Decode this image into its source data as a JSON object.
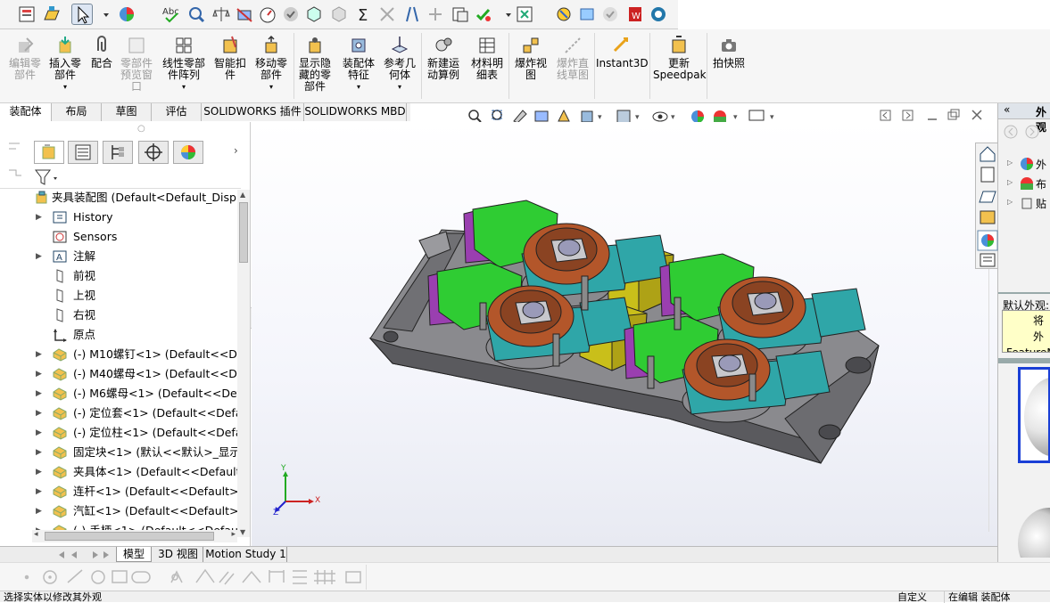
{
  "ribbon": {
    "edit_component": "编辑零\n部件",
    "insert_component": "插入零\n部件",
    "mate": "配合",
    "component_preview": "零部件\n预览窗\n口",
    "linear_pattern": "线性零部\n件阵列",
    "smart_fastener": "智能扣\n件",
    "move_component": "移动零\n部件",
    "show_hidden": "显示隐\n藏的零\n部件",
    "assembly_feature": "装配体\n特征",
    "reference_geometry": "参考几\n何体",
    "new_motion_study": "新建运\n动算例",
    "bom": "材料明\n细表",
    "exploded_view": "爆炸视\n图",
    "explode_line": "爆炸直\n线草图",
    "instant3d": "Instant3D",
    "update_speedpak": "更新\nSpeedpak",
    "snapshot": "拍快照"
  },
  "command_tabs": [
    "装配体",
    "布局",
    "草图",
    "评估",
    "SOLIDWORKS 插件",
    "SOLIDWORKS MBD"
  ],
  "tree": {
    "root": "夹具装配图 (Default<Default_Displa",
    "items": [
      {
        "label": "History",
        "expand": true,
        "icon": "history"
      },
      {
        "label": "Sensors",
        "expand": false,
        "icon": "sensor"
      },
      {
        "label": "注解",
        "expand": true,
        "icon": "annotation"
      },
      {
        "label": "前视",
        "expand": false,
        "icon": "plane"
      },
      {
        "label": "上视",
        "expand": false,
        "icon": "plane"
      },
      {
        "label": "右视",
        "expand": false,
        "icon": "plane"
      },
      {
        "label": "原点",
        "expand": false,
        "icon": "origin"
      },
      {
        "label": "(-) M10螺钉<1> (Default<<Defa",
        "expand": true,
        "icon": "part"
      },
      {
        "label": "(-) M40螺母<1> (Default<<Defa",
        "expand": true,
        "icon": "part"
      },
      {
        "label": "(-) M6螺母<1> (Default<<Defau",
        "expand": true,
        "icon": "part"
      },
      {
        "label": "(-) 定位套<1> (Default<<Defaul",
        "expand": true,
        "icon": "part"
      },
      {
        "label": "(-) 定位柱<1> (Default<<Defaul",
        "expand": true,
        "icon": "part"
      },
      {
        "label": "固定块<1> (默认<<默认>_显示状",
        "expand": true,
        "icon": "part"
      },
      {
        "label": "夹具体<1> (Default<<Default>_",
        "expand": true,
        "icon": "part"
      },
      {
        "label": "连杆<1> (Default<<Default>_Ph",
        "expand": true,
        "icon": "part"
      },
      {
        "label": "汽缸<1> (Default<<Default>_Ph",
        "expand": true,
        "icon": "part"
      },
      {
        "label": "(-) 手柄<1> (Default<<Default",
        "expand": true,
        "icon": "part"
      }
    ]
  },
  "bottom_tabs": [
    "模型",
    "3D 视图",
    "Motion Study 1"
  ],
  "right_panel": {
    "header": "外观",
    "default_label": "默认外观:",
    "tooltip_line1": "将外",
    "tooltip_line2": "FeatureM",
    "tree_items": [
      "外",
      "布",
      "贴"
    ]
  },
  "status": {
    "left": "选择实体以修改其外观",
    "custom": "自定义",
    "editing": "在编辑 装配体"
  },
  "triad": {
    "x": "X",
    "y": "Y",
    "z": "Z"
  },
  "colors": {
    "base": "#6e6e72",
    "green": "#2fcc33",
    "teal": "#2fa6a8",
    "purple": "#9a3fb0",
    "orange": "#b3562a",
    "yellow": "#c9bf1a"
  }
}
